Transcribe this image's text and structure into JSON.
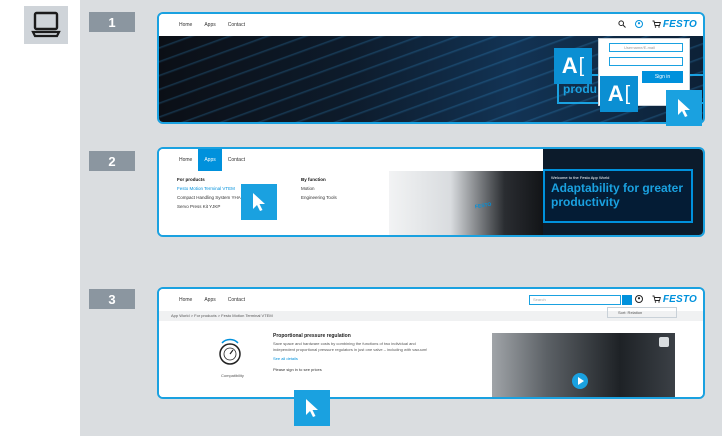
{
  "steps": [
    "1",
    "2",
    "3"
  ],
  "colors": {
    "accent": "#0091dc",
    "stage": "#dadde0",
    "badge": "#8b96a0"
  },
  "nav": {
    "home": "Home",
    "apps": "Apps",
    "contact": "Contact"
  },
  "logo": "FESTO",
  "panel1": {
    "username_placeholder": "Username/E-mail",
    "signin": "Sign in",
    "hero_text": "produ",
    "text_cursor_glyph": "A"
  },
  "panel2": {
    "for_products_head": "For products",
    "for_products_items": [
      "Festo Motion Terminal VTEM",
      "Compact Handling System YHA",
      "Servo Press Kit YJKP"
    ],
    "by_function_head": "By function",
    "by_function_items": [
      "Motion",
      "Engineering Tools"
    ],
    "promo_small": "Welcome to the Festo App World",
    "promo_big_line1": "Adaptability for greater",
    "promo_big_line2": "productivity",
    "machine_brand": "FESTO"
  },
  "panel3": {
    "search_placeholder": "Search",
    "breadcrumb": "App World  >  For products  >  Festo Motion Terminal VTEM",
    "sort": "Sort: Relation",
    "title": "Proportional pressure regulation",
    "desc": "Save space and hardware costs by combining the functions of two individual and independent proportional pressure regulators in just one valve – including with vacuum!",
    "see_all": "See all details",
    "price": "Please sign in to see prices",
    "compat": "Compatibility"
  }
}
